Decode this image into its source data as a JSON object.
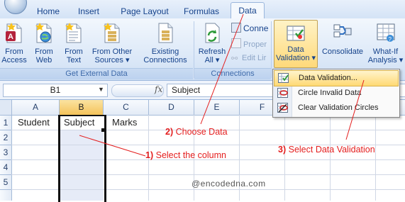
{
  "tabs": [
    {
      "label": "Home"
    },
    {
      "label": "Insert"
    },
    {
      "label": "Page Layout"
    },
    {
      "label": "Formulas"
    },
    {
      "label": "Data",
      "active": true
    }
  ],
  "ribbon": {
    "get_external_data": {
      "group_label": "Get External Data",
      "from_access": "From\nAccess",
      "from_web": "From\nWeb",
      "from_text": "From\nText",
      "from_other_sources": "From Other\nSources ▾",
      "existing_connections": "Existing\nConnections"
    },
    "connections": {
      "group_label": "Connections",
      "refresh_all": "Refresh\nAll ▾",
      "connections_btn": "Conne",
      "properties_btn": "Proper",
      "edit_links_btn": "Edit Lir"
    },
    "data_tools": {
      "data_validation": "Data\nValidation ▾",
      "consolidate": "Consolidate",
      "what_if": "What-If\nAnalysis ▾"
    }
  },
  "formula_bar": {
    "name_box": "B1",
    "fx_label": "fx",
    "formula": "Subject"
  },
  "grid": {
    "columns": [
      "A",
      "B",
      "C",
      "D",
      "E",
      "F"
    ],
    "rows": [
      "1",
      "2",
      "3",
      "4",
      "5"
    ],
    "cells": {
      "A1": "Student",
      "B1": "Subject",
      "C1": "Marks"
    }
  },
  "menu": {
    "items": [
      {
        "label": "Data Validation...",
        "icon": "data-validation-icon",
        "highlighted": true
      },
      {
        "label": "Circle Invalid Data",
        "icon": "circle-invalid-icon"
      },
      {
        "label": "Clear Validation Circles",
        "icon": "clear-circles-icon"
      }
    ]
  },
  "annotations": {
    "step1_num": "1)",
    "step1_text": "Select the column",
    "step2_num": "2)",
    "step2_text": "Choose Data",
    "step3_num": "3)",
    "step3_text": "Select Data Validation",
    "watermark": "@encodedna.com"
  },
  "colors": {
    "ribbon_text": "#15428b",
    "annotation": "#e41e1e",
    "selected_header": "#f4c35a",
    "selected_column_fill": "#e6ebf7"
  }
}
